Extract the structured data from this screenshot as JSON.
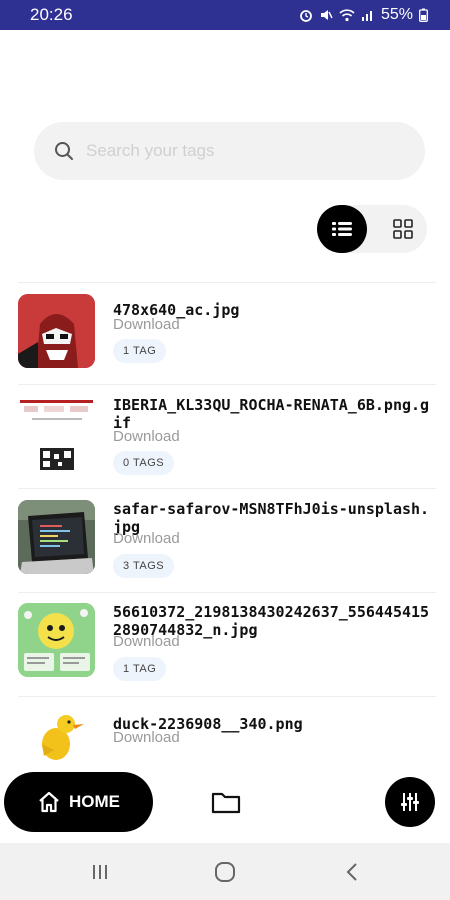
{
  "status_bar": {
    "time": "20:26",
    "battery": "55%"
  },
  "search": {
    "placeholder": "Search your tags"
  },
  "files": [
    {
      "name": "478x640_ac.jpg",
      "subtitle": "Download",
      "tags": "1 TAG"
    },
    {
      "name": "IBERIA_KL33QU_ROCHA-RENATA_6B.png.gif",
      "subtitle": "Download",
      "tags": "0 TAGS"
    },
    {
      "name": "safar-safarov-MSN8TFhJ0is-unsplash.jpg",
      "subtitle": "Download",
      "tags": "3 TAGS"
    },
    {
      "name": "56610372_2198138430242637_5564454152890744832_n.jpg",
      "subtitle": "Download",
      "tags": "1 TAG"
    },
    {
      "name": "duck-2236908__340.png",
      "subtitle": "Download",
      "tags": ""
    }
  ],
  "bottom_nav": {
    "home_label": "HOME"
  },
  "colors": {
    "status_bar": "#2e3192",
    "accent": "#000000",
    "chip": "#eef4fb"
  }
}
